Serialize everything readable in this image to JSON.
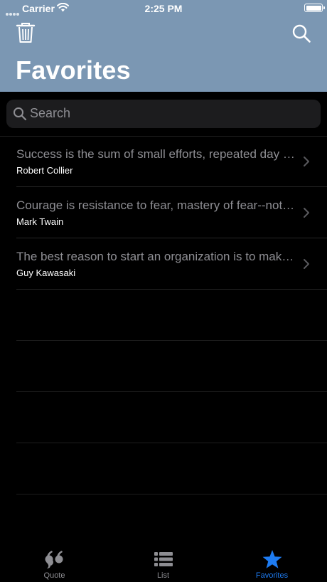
{
  "status_bar": {
    "carrier": "Carrier",
    "time": "2:25 PM"
  },
  "header": {
    "title": "Favorites",
    "background_color": "#7b97b3"
  },
  "search": {
    "placeholder": "Search"
  },
  "quotes": [
    {
      "text": "Success is the sum of small efforts, repeated day in and day out.",
      "author": "Robert Collier"
    },
    {
      "text": "Courage is resistance to fear, mastery of fear--not absence of fear.",
      "author": "Mark Twain"
    },
    {
      "text": "The best reason to start an organization is to make meaning.",
      "author": "Guy Kawasaki"
    }
  ],
  "tab_bar": {
    "tabs": [
      {
        "label": "Quote",
        "icon": "quote-icon",
        "active": false
      },
      {
        "label": "List",
        "icon": "list-icon",
        "active": false
      },
      {
        "label": "Favorites",
        "icon": "star-icon",
        "active": true
      }
    ],
    "active_color": "#1e7cf2",
    "inactive_color": "#8e8e93"
  }
}
